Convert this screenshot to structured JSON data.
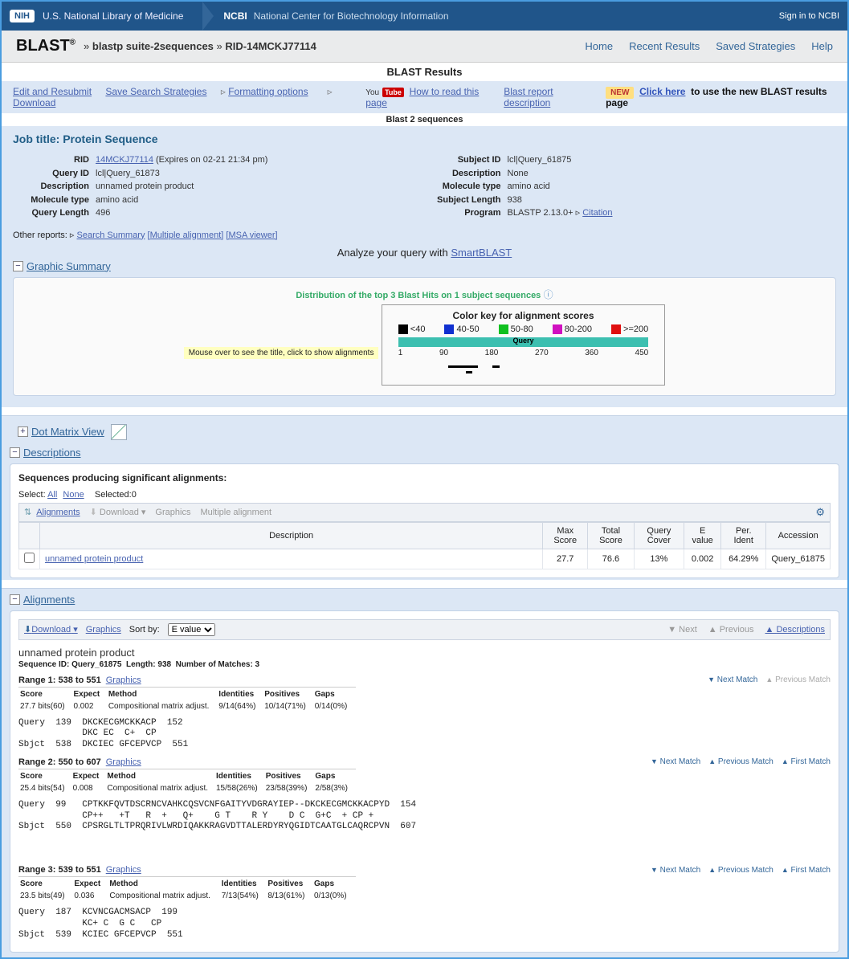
{
  "header": {
    "nih": "NIH",
    "nlm": "U.S. National Library of Medicine",
    "ncbi": "NCBI",
    "ncbi_full": "National Center for Biotechnology Information",
    "signin": "Sign in to NCBI"
  },
  "breadcrumb": {
    "logo": "BLAST",
    "sup": "®",
    "sep": "»",
    "level1": "blastp suite-2sequences",
    "level2": "RID-14MCKJ77114",
    "links": {
      "home": "Home",
      "recent": "Recent Results",
      "saved": "Saved Strategies",
      "help": "Help"
    }
  },
  "results_title": "BLAST Results",
  "tools": {
    "edit": "Edit and Resubmit",
    "save": "Save Search Strategies",
    "format": "Formatting options",
    "download": "Download",
    "yt_prefix": "You",
    "yt_badge": "Tube",
    "howto": "How to read this page",
    "report_desc": "Blast report description",
    "new": "NEW",
    "click_here": "Click here",
    "click_rest": "to use the new BLAST results page"
  },
  "b2s": "Blast 2 sequences",
  "job": {
    "title": "Job title: Protein Sequence",
    "left": {
      "rid_label": "RID",
      "rid_val": "14MCKJ77114",
      "rid_expires": "(Expires on 02-21 21:34 pm)",
      "qid_label": "Query ID",
      "qid_val": "lcl|Query_61873",
      "desc_label": "Description",
      "desc_val": "unnamed protein product",
      "mol_label": "Molecule type",
      "mol_val": "amino acid",
      "qlen_label": "Query Length",
      "qlen_val": "496"
    },
    "right": {
      "sid_label": "Subject ID",
      "sid_val": "lcl|Query_61875",
      "desc_label": "Description",
      "desc_val": "None",
      "mol_label": "Molecule type",
      "mol_val": "amino acid",
      "slen_label": "Subject Length",
      "slen_val": "938",
      "prog_label": "Program",
      "prog_val": "BLASTP 2.13.0+",
      "citation": "Citation"
    },
    "other_reports_label": "Other reports:",
    "other_reports": {
      "search_summary": "Search Summary",
      "multi_align": "[Multiple alignment]",
      "msa": "[MSA viewer]"
    },
    "smartblast_pre": "Analyze your query with ",
    "smartblast": "SmartBLAST"
  },
  "graphic": {
    "title": "Graphic Summary",
    "dist": "Distribution of the top 3 Blast Hits on 1 subject sequences",
    "hint": "Mouse over to see the title, click to show alignments",
    "key_title": "Color key for alignment scores",
    "keys": [
      {
        "color": "#000000",
        "label": "<40"
      },
      {
        "color": "#1030d0",
        "label": "40-50"
      },
      {
        "color": "#10c020",
        "label": "50-80"
      },
      {
        "color": "#d010c0",
        "label": "80-200"
      },
      {
        "color": "#e01010",
        "label": ">=200"
      }
    ],
    "query_label": "Query",
    "axis": [
      "1",
      "90",
      "180",
      "270",
      "360",
      "450"
    ]
  },
  "dotmatrix": {
    "title": "Dot Matrix View"
  },
  "descriptions": {
    "title": "Descriptions",
    "heading": "Sequences producing significant alignments:",
    "select_label": "Select:",
    "all": "All",
    "none": "None",
    "selected": "Selected:0",
    "toolbar": {
      "alignments": "Alignments",
      "download": "Download",
      "graphics": "Graphics",
      "multi": "Multiple alignment"
    },
    "cols": {
      "desc": "Description",
      "max": "Max Score",
      "total": "Total Score",
      "cover": "Query Cover",
      "evalue": "E value",
      "ident": "Per. Ident",
      "acc": "Accession"
    },
    "rows": [
      {
        "desc": "unnamed protein product",
        "max": "27.7",
        "total": "76.6",
        "cover": "13%",
        "evalue": "0.002",
        "ident": "64.29%",
        "acc": "Query_61875"
      }
    ]
  },
  "alignments": {
    "title": "Alignments",
    "toolbar": {
      "download": "Download",
      "graphics": "Graphics",
      "sortby": "Sort by:",
      "sort_value": "E value"
    },
    "nav": {
      "next": "Next",
      "prev": "Previous",
      "desc": "Descriptions",
      "next_match": "Next Match",
      "prev_match": "Previous Match",
      "first_match": "First Match"
    },
    "hsp_title": "unnamed protein product",
    "seqid": "Sequence ID: Query_61875",
    "length": "Length: 938",
    "nmatches": "Number of Matches: 3",
    "stat_hdr": {
      "score": "Score",
      "expect": "Expect",
      "method": "Method",
      "ident": "Identities",
      "pos": "Positives",
      "gaps": "Gaps"
    },
    "ranges": [
      {
        "label": "Range 1: 538 to 551",
        "graphics": "Graphics",
        "score": "27.7 bits(60)",
        "expect": "0.002",
        "method": "Compositional matrix adjust.",
        "ident": "9/14(64%)",
        "pos": "10/14(71%)",
        "gaps": "0/14(0%)",
        "show_first": false,
        "prev_enabled": false,
        "aln": "Query  139  DKCKECGMCKKACP  152\n            DKC EC  C+  CP\nSbjct  538  DKCIEC GFCEPVCP  551"
      },
      {
        "label": "Range 2: 550 to 607",
        "graphics": "Graphics",
        "score": "25.4 bits(54)",
        "expect": "0.008",
        "method": "Compositional matrix adjust.",
        "ident": "15/58(26%)",
        "pos": "23/58(39%)",
        "gaps": "2/58(3%)",
        "show_first": true,
        "prev_enabled": true,
        "aln": "Query  99   CPTKKFQVTDSCRNCVAHKCQSVCNFGAITYVDGRAYIEP--DKCKECGMCKKACPYD  154\n            CP++   +T   R  +   Q+    G T    R Y    D C  G+C  + CP +\nSbjct  550  CPSRGLTLTPRQRIVLWRDIQAKKRAGVDTTALERDYRYQGIDTCAATGLCAQRCPVN  607"
      },
      {
        "label": "Range 3: 539 to 551",
        "graphics": "Graphics",
        "score": "23.5 bits(49)",
        "expect": "0.036",
        "method": "Compositional matrix adjust.",
        "ident": "7/13(54%)",
        "pos": "8/13(61%)",
        "gaps": "0/13(0%)",
        "show_first": true,
        "prev_enabled": true,
        "aln": "Query  187  KCVNCGACMSACP  199\n            KC+ C  G C   CP\nSbjct  539  KCIEC GFCEPVCP  551"
      }
    ]
  }
}
